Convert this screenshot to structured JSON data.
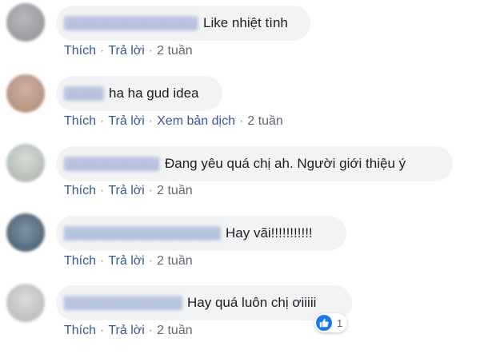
{
  "actions": {
    "like": "Thích",
    "reply": "Trả lời",
    "translate": "Xem bản dịch",
    "separator": "·"
  },
  "comments": [
    {
      "text": "Like nhiệt tình",
      "time": "2 tuần",
      "avatar_color": "#9a9a9e"
    },
    {
      "text": "ha ha gud idea",
      "time": "2 tuần",
      "avatar_color": "#b99a8a"
    },
    {
      "text": "Đang yêu quá chị ah. Người giới thiệu ý",
      "time": "2 tuần",
      "avatar_color": "#b7beb8"
    },
    {
      "text": "Hay vãi!!!!!!!!!!!",
      "time": "2 tuần",
      "avatar_color": "#5f7a92"
    },
    {
      "text": "Hay quá luôn chị ơiiiii",
      "time": "2 tuần",
      "avatar_color": "#c4c4c4"
    }
  ],
  "reaction": {
    "icon": "thumbs-up-icon",
    "count": "1",
    "color": "#1877f2"
  },
  "colors": {
    "link": "#385898",
    "bubble": "#f2f3f5",
    "time": "#616770"
  }
}
